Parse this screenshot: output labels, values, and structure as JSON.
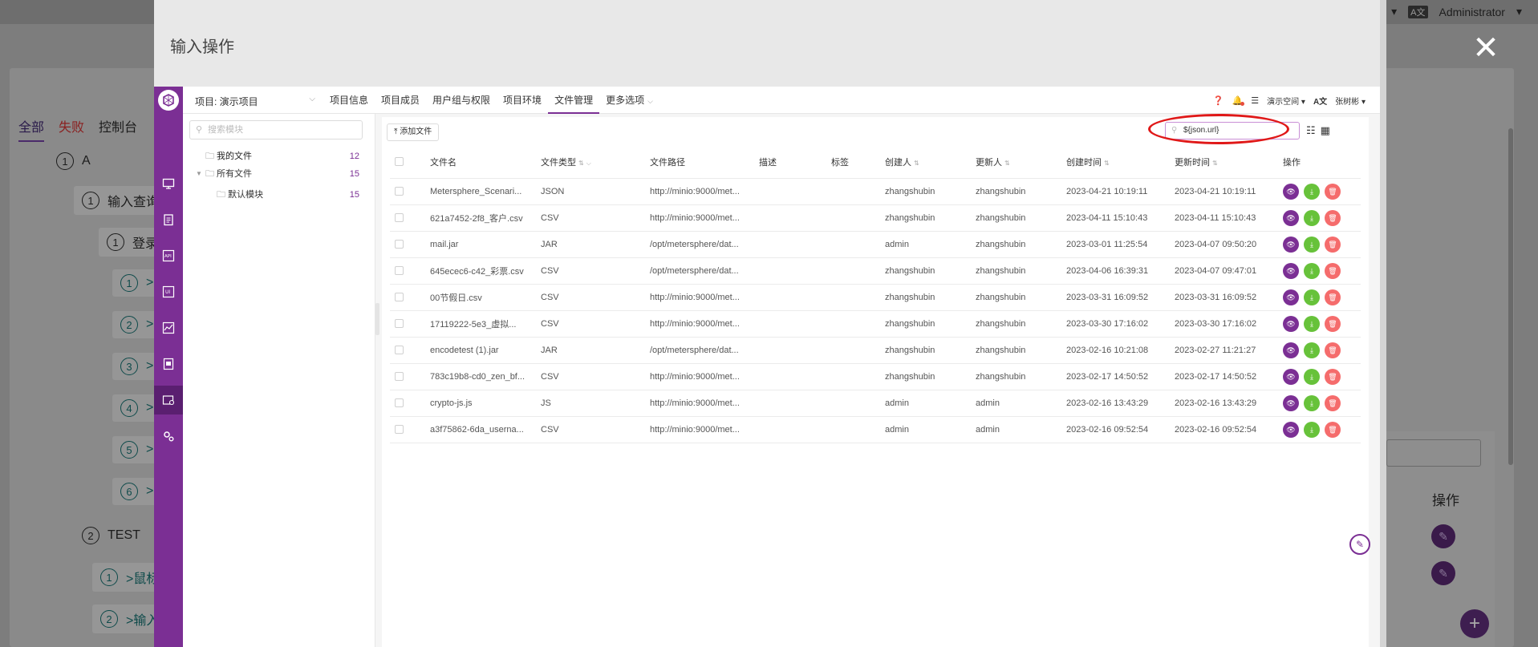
{
  "background": {
    "user": "Administrator",
    "lang_badge": "A文",
    "tabs": [
      "全部",
      "失败",
      "控制台"
    ],
    "tree": [
      {
        "num": "1",
        "label": "A"
      },
      {
        "num": "1",
        "label": "输入查询"
      },
      {
        "num": "1",
        "label": "登录A"
      },
      {
        "num": "1",
        "label": ">"
      },
      {
        "num": "2",
        "label": ">"
      },
      {
        "num": "3",
        "label": ">"
      },
      {
        "num": "4",
        "label": ">"
      },
      {
        "num": "5",
        "label": ">"
      },
      {
        "num": "6",
        "label": ">"
      },
      {
        "num": "2",
        "label": "TEST"
      },
      {
        "num": "1",
        "label": ">鼠标"
      },
      {
        "num": "2",
        "label": ">输入"
      }
    ],
    "op_label": "操作"
  },
  "dialog": {
    "title": "输入操作"
  },
  "nav": {
    "project": "项目: 演示项目",
    "items": [
      "项目信息",
      "项目成员",
      "用户组与权限",
      "项目环境",
      "文件管理",
      "更多选项"
    ],
    "active_index": 4,
    "workspace": "演示空间",
    "lang": "A文",
    "user": "张树彬"
  },
  "tree_panel": {
    "search_placeholder": "搜索模块",
    "nodes": [
      {
        "label": "我的文件",
        "count": "12"
      },
      {
        "label": "所有文件",
        "count": "15"
      },
      {
        "label": "默认模块",
        "count": "15"
      }
    ]
  },
  "toolbar": {
    "add_file": "添加文件",
    "search_value": "${json.url}"
  },
  "table": {
    "headers": [
      "文件名",
      "文件类型",
      "文件路径",
      "描述",
      "标签",
      "创建人",
      "更新人",
      "创建时间",
      "更新时间",
      "操作"
    ],
    "rows": [
      [
        "Metersphere_Scenari...",
        "JSON",
        "http://minio:9000/met...",
        "",
        "",
        "zhangshubin",
        "zhangshubin",
        "2023-04-21 10:19:11",
        "2023-04-21 10:19:11"
      ],
      [
        "621a7452-2f8_客户.csv",
        "CSV",
        "http://minio:9000/met...",
        "",
        "",
        "zhangshubin",
        "zhangshubin",
        "2023-04-11 15:10:43",
        "2023-04-11 15:10:43"
      ],
      [
        "mail.jar",
        "JAR",
        "/opt/metersphere/dat...",
        "",
        "",
        "admin",
        "zhangshubin",
        "2023-03-01 11:25:54",
        "2023-04-07 09:50:20"
      ],
      [
        "645ecec6-c42_彩票.csv",
        "CSV",
        "/opt/metersphere/dat...",
        "",
        "",
        "zhangshubin",
        "zhangshubin",
        "2023-04-06 16:39:31",
        "2023-04-07 09:47:01"
      ],
      [
        "00节假日.csv",
        "CSV",
        "http://minio:9000/met...",
        "",
        "",
        "zhangshubin",
        "zhangshubin",
        "2023-03-31 16:09:52",
        "2023-03-31 16:09:52"
      ],
      [
        "17119222-5e3_虚拟...",
        "CSV",
        "http://minio:9000/met...",
        "",
        "",
        "zhangshubin",
        "zhangshubin",
        "2023-03-30 17:16:02",
        "2023-03-30 17:16:02"
      ],
      [
        "encodetest (1).jar",
        "JAR",
        "/opt/metersphere/dat...",
        "",
        "",
        "zhangshubin",
        "zhangshubin",
        "2023-02-16 10:21:08",
        "2023-02-27 11:21:27"
      ],
      [
        "783c19b8-cd0_zen_bf...",
        "CSV",
        "http://minio:9000/met...",
        "",
        "",
        "zhangshubin",
        "zhangshubin",
        "2023-02-17 14:50:52",
        "2023-02-17 14:50:52"
      ],
      [
        "crypto-js.js",
        "JS",
        "http://minio:9000/met...",
        "",
        "",
        "admin",
        "admin",
        "2023-02-16 13:43:29",
        "2023-02-16 13:43:29"
      ],
      [
        "a3f75862-6da_userna...",
        "CSV",
        "http://minio:9000/met...",
        "",
        "",
        "admin",
        "admin",
        "2023-02-16 09:52:54",
        "2023-02-16 09:52:54"
      ]
    ]
  },
  "colors": {
    "brand": "#7b2f94",
    "success": "#67c23a",
    "danger": "#f56c6c",
    "highlight": "#e01818"
  }
}
